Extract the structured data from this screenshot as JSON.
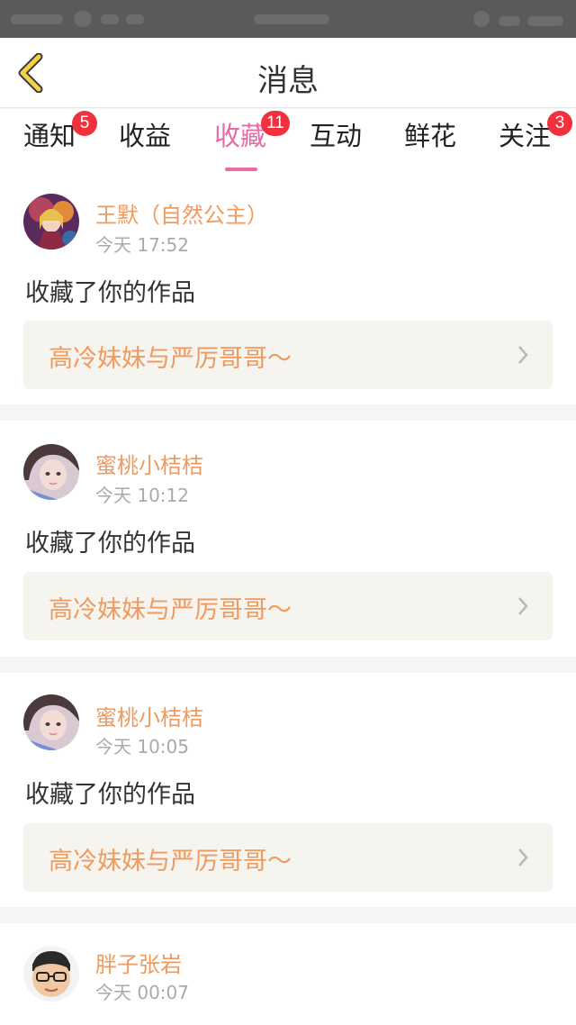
{
  "nav": {
    "title": "消息"
  },
  "tabs": [
    {
      "label": "通知",
      "badge": "5"
    },
    {
      "label": "收益",
      "badge": ""
    },
    {
      "label": "收藏",
      "badge": "11",
      "active": true
    },
    {
      "label": "互动",
      "badge": ""
    },
    {
      "label": "鲜花",
      "badge": ""
    },
    {
      "label": "关注",
      "badge": "3"
    }
  ],
  "items": [
    {
      "user": "王默（自然公主）",
      "time": "今天 17:52",
      "action": "收藏了你的作品",
      "work": "高冷妹妹与严厉哥哥～"
    },
    {
      "user": "蜜桃小桔桔",
      "time": "今天 10:12",
      "action": "收藏了你的作品",
      "work": "高冷妹妹与严厉哥哥～"
    },
    {
      "user": "蜜桃小桔桔",
      "time": "今天 10:05",
      "action": "收藏了你的作品",
      "work": "高冷妹妹与严厉哥哥～"
    },
    {
      "user": "胖子张岩",
      "time": "今天 00:07"
    }
  ],
  "colors": {
    "accent": "#e96aa6",
    "username": "#ef9a5f",
    "badge": "#f2313f",
    "back_chevron": "#f0d24a"
  },
  "icons": {
    "back": "chevron-left-icon",
    "work_arrow": "chevron-right-icon"
  }
}
